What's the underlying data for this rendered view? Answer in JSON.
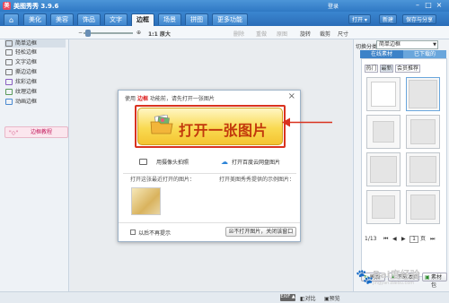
{
  "titlebar": {
    "app_title": "美图秀秀 3.9.6",
    "logo_glyph": "美",
    "login": "登录",
    "win_buttons": [
      "–",
      "□",
      "×"
    ]
  },
  "tabs": [
    {
      "label": "美化"
    },
    {
      "label": "美容"
    },
    {
      "label": "饰品"
    },
    {
      "label": "文字"
    },
    {
      "label": "边框"
    },
    {
      "label": "场景"
    },
    {
      "label": "拼图"
    },
    {
      "label": "更多功能 ▾"
    }
  ],
  "active_tab": "边框",
  "tab_actions": {
    "open": "打开 ▾",
    "new": "新建",
    "save_share": "保存与分享"
  },
  "toolbar": {
    "zoom_label": "1:1 原大",
    "delete": "删除",
    "redo": "重做",
    "reset": "原图",
    "rotate": "旋转",
    "crop": "裁剪",
    "size": "尺寸"
  },
  "sidebar": {
    "items": [
      {
        "label": "简单边框"
      },
      {
        "label": "轻松边框"
      },
      {
        "label": "文字边框"
      },
      {
        "label": "撕边边框"
      },
      {
        "label": "炫彩边框"
      },
      {
        "label": "纹理边框"
      },
      {
        "label": "动画边框"
      }
    ],
    "help_label": "边框教程"
  },
  "dialog": {
    "title_prefix": "使用",
    "title_highlight": "边框",
    "title_suffix": "功能前，请先打开一张图片",
    "open_button": "打开一张图片",
    "camera_button": "用摄像头拍照",
    "cloud_button": "打开百度云网盘图片",
    "recent_label": "打开这张最近打开的图片：",
    "sample_label": "打开美图秀秀提供的示例图片：",
    "dont_show": "以后不再提示",
    "skip_button": "不打开图片，关闭该窗口"
  },
  "right_panel": {
    "category_label": "切换分类",
    "category_value": "简单边框",
    "tabs": [
      "在线素材",
      "已下载的"
    ],
    "subtabs": [
      "热门",
      "最新",
      "会员推荐"
    ],
    "active_subtab": "最新",
    "pager": "1/13",
    "page_input": "1",
    "page_suffix": "页",
    "buttons": {
      "refresh": "刷新",
      "download": "下载本页",
      "mine": "素材包"
    }
  },
  "statusbar": {
    "exif": "EXIF ▲",
    "compare": "对比",
    "preview": "预览"
  },
  "watermark": {
    "text": "Bai度经验",
    "sub": "jingyan.baidu.com"
  },
  "colors": {
    "accent_blue": "#2f78c4",
    "highlight_red": "#d9321f",
    "button_yellow": "#f9da52"
  }
}
